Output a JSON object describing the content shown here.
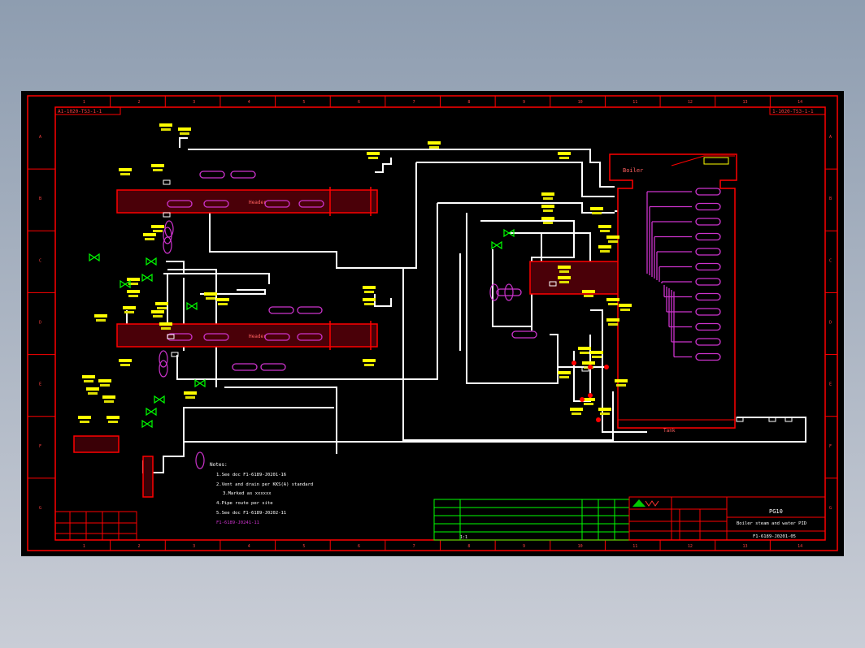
{
  "drawing": {
    "code_top_left": "A1-1020-TS3-1-1",
    "code_top_right": "1-1020-TS3-1-1",
    "grid_numbers": [
      "1",
      "2",
      "3",
      "4",
      "5",
      "6",
      "7",
      "8",
      "9",
      "10",
      "11",
      "12",
      "13",
      "14"
    ],
    "grid_letters": [
      "A",
      "B",
      "C",
      "D",
      "E",
      "F",
      "G"
    ],
    "device_label_boiler": "Boiler",
    "device_label_header": "Header",
    "device_label_tank": "Tank",
    "notes_title": "Notes:",
    "notes": [
      "1.See doc F1-6189-J0201-16",
      "2.Vent and drain per KKS(A) standard",
      "3.Marked as xxxxxx",
      "4.Pipe route per site",
      "5.See doc F1-6189-J0202-11"
    ],
    "notes_highlight": "F1-6189-J0241-11",
    "title_block": {
      "project": "PG10",
      "title": "Boiler steam and water PID",
      "drawing_no": "F1-6189-J0201-05",
      "scale_label": "1:1"
    }
  },
  "colors": {
    "sheet": "#000000",
    "frame": "#ff0000",
    "pipe": "#ffffff",
    "tag": "#ffff00",
    "instrument": "#ff00ff",
    "valve": "#00ff00",
    "vessel": "#ff0000"
  },
  "icons": [
    "valve-icon",
    "instrument-icon",
    "vessel-icon",
    "logo-icon"
  ]
}
